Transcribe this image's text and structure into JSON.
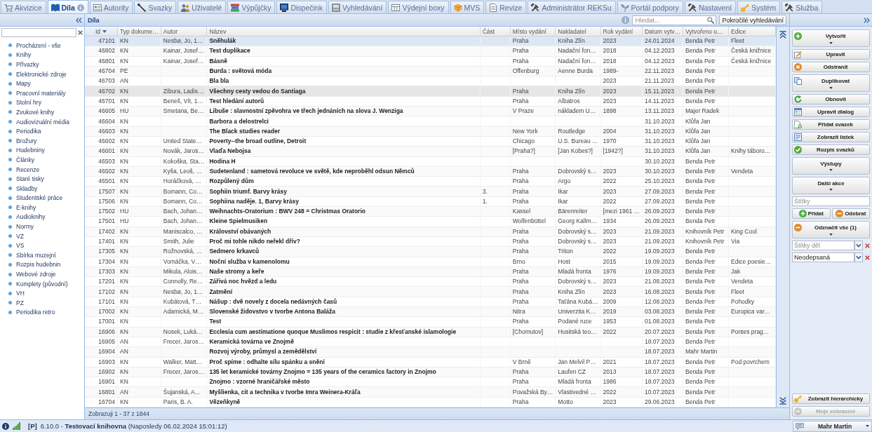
{
  "tabs": [
    {
      "label": "Akvizice",
      "selected": false
    },
    {
      "label": "Díla",
      "selected": true
    },
    {
      "label": "Autority",
      "selected": false
    },
    {
      "label": "Svazky",
      "selected": false
    },
    {
      "label": "Uživatelé",
      "selected": false
    },
    {
      "label": "Výpůjčky",
      "selected": false
    },
    {
      "label": "Dispečink",
      "selected": false
    },
    {
      "label": "Vyhledávání",
      "selected": false
    },
    {
      "label": "Výdejní boxy",
      "selected": false
    },
    {
      "label": "MVS",
      "selected": false
    },
    {
      "label": "Revize",
      "selected": false
    },
    {
      "label": "Administrátor REKSu",
      "selected": false
    },
    {
      "label": "Portál podpory",
      "selected": false
    },
    {
      "label": "Nastavení",
      "selected": false
    },
    {
      "label": "Systém",
      "selected": false
    },
    {
      "label": "Služba",
      "selected": false
    }
  ],
  "sidebar": {
    "items": [
      {
        "label": "Procházení - vše",
        "selected": false
      },
      {
        "label": "Knihy",
        "selected": false
      },
      {
        "label": "Přívazky",
        "selected": false
      },
      {
        "label": "Elektronické zdroje",
        "selected": false
      },
      {
        "label": "Mapy",
        "selected": false
      },
      {
        "label": "Pracovní materiály",
        "selected": false
      },
      {
        "label": "Stolní hry",
        "selected": false
      },
      {
        "label": "Zvukové knihy",
        "selected": false
      },
      {
        "label": "Audiovizuální média",
        "selected": false
      },
      {
        "label": "Periodika",
        "selected": false
      },
      {
        "label": "Brožury",
        "selected": false
      },
      {
        "label": "Hudebniny",
        "selected": false
      },
      {
        "label": "Články",
        "selected": false
      },
      {
        "label": "Recenze",
        "selected": false
      },
      {
        "label": "Staré tisky",
        "selected": false
      },
      {
        "label": "Skladby",
        "selected": false
      },
      {
        "label": "Studentské práce",
        "selected": false
      },
      {
        "label": "E-knihy",
        "selected": false
      },
      {
        "label": "Audioknihy",
        "selected": false
      },
      {
        "label": "Normy",
        "selected": false
      },
      {
        "label": "VZ",
        "selected": false
      },
      {
        "label": "VS",
        "selected": false
      },
      {
        "label": "Sbírka muzejní",
        "selected": false
      },
      {
        "label": "Rozpis hudebnin",
        "selected": false
      },
      {
        "label": "Webové zdroje",
        "selected": false
      },
      {
        "label": "Komplety (původní)",
        "selected": false
      },
      {
        "label": "VH",
        "selected": false
      },
      {
        "label": "PZ",
        "selected": false
      },
      {
        "label": "Periodika retro",
        "selected": false
      }
    ]
  },
  "grid": {
    "title": "Díla",
    "search": {
      "placeholder": "Hledat..."
    },
    "advanced_search": "Pokročilé vyhledávání",
    "columns": [
      {
        "label": "Id",
        "kind": "number",
        "sorted": true
      },
      {
        "label": "Typ dokume…",
        "kind": "text",
        "sorted": false
      },
      {
        "label": "Autor",
        "kind": "text",
        "sorted": false
      },
      {
        "label": "Název",
        "kind": "title",
        "sorted": false
      },
      {
        "label": "Část",
        "kind": "text",
        "sorted": false
      },
      {
        "label": "Místo vydání",
        "kind": "text",
        "sorted": false
      },
      {
        "label": "Nakladatel",
        "kind": "text",
        "sorted": false
      },
      {
        "label": "Rok vydání",
        "kind": "text",
        "sorted": false
      },
      {
        "label": "Datum vytv…",
        "kind": "text",
        "sorted": false
      },
      {
        "label": "Vytvořeno u…",
        "kind": "text",
        "sorted": false
      },
      {
        "label": "Edice",
        "kind": "text",
        "sorted": false
      }
    ],
    "rows": [
      {
        "id": "47101",
        "type": "KN",
        "author": "Nesbø, Jo, 1…",
        "title": "Sněhulák",
        "place": "Praha",
        "publisher": "Kniha Zlín",
        "year": "2023",
        "created": "24.01.2024",
        "creator": "Benda Petr",
        "series": "Fleet",
        "selected": true,
        "hovered": false
      },
      {
        "id": "46802",
        "type": "KN",
        "author": "Kainar, Josef…",
        "title": "Test duplikace",
        "place": "Praha",
        "publisher": "Nadační fon…",
        "year": "2018",
        "created": "04.12.2023",
        "creator": "Benda Petr",
        "series": "Česká knižnice",
        "selected": false,
        "hovered": false
      },
      {
        "id": "46801",
        "type": "KN",
        "author": "Kainar, Josef…",
        "title": "Básně",
        "place": "Praha",
        "publisher": "Nadační fon…",
        "year": "2018",
        "created": "04.12.2023",
        "creator": "Benda Petr",
        "series": "Česká knižnice",
        "selected": false,
        "hovered": false
      },
      {
        "id": "46704",
        "type": "PE",
        "title": "Burda : světová móda",
        "place": "Offenburg",
        "publisher": "Aenne Burda",
        "year": "1989-",
        "created": "22.11.2023",
        "creator": "Benda Petr",
        "selected": false,
        "hovered": false
      },
      {
        "id": "46703",
        "type": "AN",
        "title": "Bla bla",
        "year": "2023",
        "created": "21.11.2023",
        "creator": "Benda Petr",
        "selected": false,
        "hovered": false
      },
      {
        "id": "46702",
        "type": "KN",
        "author": "Zibura, Ladis…",
        "title": "Všechny cesty vedou do Santiaga",
        "place": "Praha",
        "publisher": "Kniha Zlín",
        "year": "2023",
        "created": "15.11.2023",
        "creator": "Benda Petr",
        "selected": false,
        "hovered": true
      },
      {
        "id": "46701",
        "type": "KN",
        "author": "Beneš, Vít, 1…",
        "title": "Test hledání autorů",
        "place": "Praha",
        "publisher": "Albatros",
        "year": "2023",
        "created": "14.11.2023",
        "creator": "Benda Petr",
        "selected": false,
        "hovered": false
      },
      {
        "id": "46605",
        "type": "HU",
        "author": "Smetana, Be…",
        "title": "Libuše : slavnostní zpěvohra ve třech jednáních na slova J. Wenziga",
        "place": "V Praze",
        "publisher": "nákladem U…",
        "year": "1898",
        "created": "13.11.2023",
        "creator": "Majer Radek",
        "selected": false,
        "hovered": false
      },
      {
        "id": "46604",
        "type": "KN",
        "title": "Barbora a delostrelci",
        "created": "31.10.2023",
        "creator": "Klůfa Jan",
        "selected": false,
        "hovered": false
      },
      {
        "id": "46603",
        "type": "KN",
        "title": "The Black studies reader",
        "place": "New York",
        "publisher": "Routledge",
        "year": "2004",
        "created": "31.10.2023",
        "creator": "Klůfa Jan",
        "selected": false,
        "hovered": false
      },
      {
        "id": "46602",
        "type": "KN",
        "author": "United State…",
        "title": "Poverty--the broad outline, Detroit",
        "place": "Chicago",
        "publisher": "U.S. Bureau …",
        "year": "1970",
        "created": "31.10.2023",
        "creator": "Klůfa Jan",
        "selected": false,
        "hovered": false
      },
      {
        "id": "46601",
        "type": "KN",
        "author": "Novák, Jaros…",
        "title": "Vlaďa Nebojsa",
        "place": "[Praha?]",
        "publisher": "[Jan Kobes?]",
        "year": "[1942?]",
        "created": "31.10.2023",
        "creator": "Klůfa Jan",
        "series": "Knihy táboro…",
        "selected": false,
        "hovered": false
      },
      {
        "id": "46503",
        "type": "KN",
        "author": "Kokoška, Sta…",
        "title": "Hodina H",
        "created": "30.10.2023",
        "creator": "Benda Petr",
        "selected": false,
        "hovered": false
      },
      {
        "id": "46502",
        "type": "KN",
        "author": "Kyša, Leoš, …",
        "title": "Sudetenland : sametová revoluce ve světě, kde neproběhl odsun Němců",
        "place": "Praha",
        "publisher": "Dobrovský s…",
        "year": "2023",
        "created": "30.10.2023",
        "creator": "Benda Petr",
        "series": "Vendeta",
        "selected": false,
        "hovered": false
      },
      {
        "id": "46501",
        "type": "KN",
        "author": "Horáčková, …",
        "title": "Rozpůlený dům",
        "place": "Praha",
        "publisher": "Argo",
        "year": "2022",
        "created": "25.10.2023",
        "creator": "Benda Petr",
        "selected": false,
        "hovered": false
      },
      {
        "id": "17507",
        "type": "KN",
        "author": "Bomann, Co…",
        "title": "Sophiin triumf. Barvy krásy",
        "part": "3.",
        "place": "Praha",
        "publisher": "Ikar",
        "year": "2023",
        "created": "27.09.2023",
        "creator": "Benda Petr",
        "selected": false,
        "hovered": false
      },
      {
        "id": "17506",
        "type": "KN",
        "author": "Bomann, Co…",
        "title": "Sophiina naděje. 1, Barvy krásy",
        "part": "1.",
        "place": "Praha",
        "publisher": "Ikar",
        "year": "2022",
        "created": "27.09.2023",
        "creator": "Benda Petr",
        "selected": false,
        "hovered": false
      },
      {
        "id": "17502",
        "type": "HU",
        "author": "Bach, Johan…",
        "title": "Weihnachts-Oratorium : BWV 248 = Christmas Oratorio",
        "place": "Kassel",
        "publisher": "Bärenreiter",
        "year": "[mezi 1961 …",
        "created": "26.09.2023",
        "creator": "Benda Petr",
        "selected": false,
        "hovered": false
      },
      {
        "id": "17501",
        "type": "HU",
        "author": "Bach, Johan…",
        "title": "Kleine Spielmusiken",
        "place": "Wolfenbüttel",
        "publisher": "Georg Kallm…",
        "year": "1934",
        "created": "26.09.2023",
        "creator": "Benda Petr",
        "selected": false,
        "hovered": false
      },
      {
        "id": "17402",
        "type": "KN",
        "author": "Maniscalco, …",
        "title": "Království obávaných",
        "place": "Praha",
        "publisher": "Dobrovský s…",
        "year": "2023",
        "created": "21.09.2023",
        "creator": "Knihovník Petr",
        "series": "King Cool",
        "selected": false,
        "hovered": false
      },
      {
        "id": "17401",
        "type": "KN",
        "author": "Smith, Julie",
        "title": "Proč mi tohle nikdo neřekl dřív?",
        "place": "Praha",
        "publisher": "Dobrovský s…",
        "year": "2023",
        "created": "21.09.2023",
        "creator": "Knihovník Petr",
        "series": "Via",
        "selected": false,
        "hovered": false
      },
      {
        "id": "17305",
        "type": "KN",
        "author": "Rožnovská, …",
        "title": "Sedmero krkavců",
        "place": "Praha",
        "publisher": "Triton",
        "year": "2022",
        "created": "19.09.2023",
        "creator": "Benda Petr",
        "selected": false,
        "hovered": false
      },
      {
        "id": "17304",
        "type": "KN",
        "author": "Vomáčka, V…",
        "title": "Noční služba v kamenolomu",
        "place": "Brno",
        "publisher": "Host",
        "year": "2015",
        "created": "19.09.2023",
        "creator": "Benda Petr",
        "series": "Edice poesie…",
        "selected": false,
        "hovered": false
      },
      {
        "id": "17303",
        "type": "KN",
        "author": "Mikula, Alois…",
        "title": "Naše stromy a keře",
        "place": "Praha",
        "publisher": "Mladá fronta",
        "year": "1976",
        "created": "19.09.2023",
        "creator": "Benda Petr",
        "series": "Jak",
        "selected": false,
        "hovered": false
      },
      {
        "id": "17201",
        "type": "KN",
        "author": "Connolly, Re…",
        "title": "Zářivá noc hvězd a ledu",
        "place": "Praha",
        "publisher": "Dobrovský s…",
        "year": "2023",
        "created": "21.08.2023",
        "creator": "Benda Petr",
        "series": "Vendeta",
        "selected": false,
        "hovered": false
      },
      {
        "id": "17102",
        "type": "KN",
        "author": "Nesbø, Jo, 1…",
        "title": "Zatmění",
        "place": "Praha",
        "publisher": "Kniha Zlín",
        "year": "2023",
        "created": "16.08.2023",
        "creator": "Benda Petr",
        "series": "Fleet",
        "selected": false,
        "hovered": false
      },
      {
        "id": "17101",
        "type": "KN",
        "author": "Kubátová, T…",
        "title": "Nášup : dvě novely z docela nedávných časů",
        "place": "Praha",
        "publisher": "Taťána Kubá…",
        "year": "2009",
        "created": "12.08.2023",
        "creator": "Benda Petr",
        "series": "Pohodky",
        "selected": false,
        "hovered": false
      },
      {
        "id": "17002",
        "type": "KN",
        "author": "Adamická, M…",
        "title": "Slovenské židovstvo v tvorbe Antona Baláža",
        "place": "Nitra",
        "publisher": "Univerzita K…",
        "year": "2019",
        "created": "03.08.2023",
        "creator": "Benda Petr",
        "series": "Europica var…",
        "selected": false,
        "hovered": false
      },
      {
        "id": "17001",
        "type": "KN",
        "title": "Test",
        "place": "Praha",
        "publisher": "Podané ruce",
        "year": "1953",
        "created": "01.08.2023",
        "creator": "Benda Petr",
        "selected": false,
        "hovered": false
      },
      {
        "id": "16906",
        "type": "KN",
        "author": "Nosek, Luká…",
        "title": "Ecclesia cum aestimatione quoque Muslimos respicit : studie z křesťanské islamologie",
        "place": "[Chomutov]",
        "publisher": "Husitská teo…",
        "year": "2022",
        "created": "20.07.2023",
        "creator": "Benda Petr",
        "series": "Pontes prag…",
        "selected": false,
        "hovered": false
      },
      {
        "id": "16905",
        "type": "AN",
        "author": "Frecer, Jaros…",
        "title": "Keramická továrna ve Znojmě",
        "created": "18.07.2023",
        "creator": "Benda Petr",
        "selected": false,
        "hovered": false
      },
      {
        "id": "16904",
        "type": "AN",
        "title": "Rozvoj výroby, průmysl a zemědělství",
        "created": "18.07.2023",
        "creator": "Mahr Martin",
        "selected": false,
        "hovered": false
      },
      {
        "id": "16903",
        "type": "KN",
        "author": "Walker, Matt…",
        "title": "Proč spíme : odhalte sílu spánku a snění",
        "place": "V Brně",
        "publisher": "Jan Melvil P…",
        "year": "2021",
        "created": "18.07.2023",
        "creator": "Benda Petr",
        "series": "Pod povrchem",
        "selected": false,
        "hovered": false
      },
      {
        "id": "16902",
        "type": "KN",
        "author": "Frecer, Jaros…",
        "title": "135 let keramické továrny Znojmo = 135 years of the ceramics factory in Znojmo",
        "place": "Praha",
        "publisher": "Laufen CZ",
        "year": "2013",
        "created": "18.07.2023",
        "creator": "Benda Petr",
        "selected": false,
        "hovered": false
      },
      {
        "id": "16901",
        "type": "KN",
        "title": "Znojmo : vzorné hraničářské město",
        "place": "Praha",
        "publisher": "Mladá fronta",
        "year": "1986",
        "created": "18.07.2023",
        "creator": "Benda Petr",
        "selected": false,
        "hovered": false
      },
      {
        "id": "16801",
        "type": "AN",
        "author": "Šujanská, A…",
        "title": "Myšlienka, cit a technika v tvorbe Imra Weinera-Kráľa",
        "place": "Považská By…",
        "publisher": "Vlastivedné …",
        "year": "2022",
        "created": "10.07.2023",
        "creator": "Benda Petr",
        "selected": false,
        "hovered": false
      },
      {
        "id": "16704",
        "type": "KN",
        "author": "Paris, B. A.",
        "title": "Vězeňkyně",
        "place": "Praha",
        "publisher": "Motto",
        "year": "2023",
        "created": "29.06.2023",
        "creator": "Benda Petr",
        "selected": false,
        "hovered": false
      }
    ],
    "paging": "Zobrazuji 1 - 37 z 1844"
  },
  "actions": [
    {
      "kind": "split",
      "label": "Vytvořit",
      "disabled": false
    },
    {
      "kind": "button",
      "label": "Upravit",
      "disabled": false
    },
    {
      "kind": "button",
      "label": "Odstranit",
      "disabled": false
    },
    {
      "kind": "split",
      "label": "Duplikovat",
      "disabled": false
    },
    {
      "kind": "button",
      "label": "Obnovit",
      "disabled": false
    },
    {
      "kind": "button",
      "label": "Upravit dialog",
      "disabled": false
    },
    {
      "kind": "button",
      "label": "Přidat svazek",
      "disabled": false
    },
    {
      "kind": "button",
      "label": "Zobrazit lístek",
      "disabled": false
    },
    {
      "kind": "button",
      "label": "Rozpis svazků",
      "disabled": false
    },
    {
      "kind": "split",
      "label": "Výstupy",
      "disabled": false
    },
    {
      "kind": "split",
      "label": "Další akce",
      "disabled": false
    },
    {
      "kind": "field",
      "placeholder": "Štítky"
    },
    {
      "kind": "pair",
      "buttons": [
        {
          "label": "Přidat",
          "disabled": false
        },
        {
          "label": "Odebrat",
          "disabled": false
        }
      ]
    },
    {
      "kind": "split",
      "label": "Odznačit vše (1)",
      "disabled": false
    },
    {
      "kind": "combo",
      "placeholder": "Štítky děl"
    },
    {
      "kind": "combo",
      "value": "Neodepsaná"
    }
  ],
  "bottom_actions": [
    {
      "kind": "button",
      "label": "Zobrazit hierarchicky",
      "disabled": false
    },
    {
      "kind": "button",
      "label": "Moje zobrazení",
      "disabled": true
    }
  ],
  "status_bar": {
    "mode": "[P]",
    "text": "6.10.0 - **Testovací knihovna** (Naposledy 06.02.2024 15:01:12)",
    "user": "Mahr Martin"
  }
}
